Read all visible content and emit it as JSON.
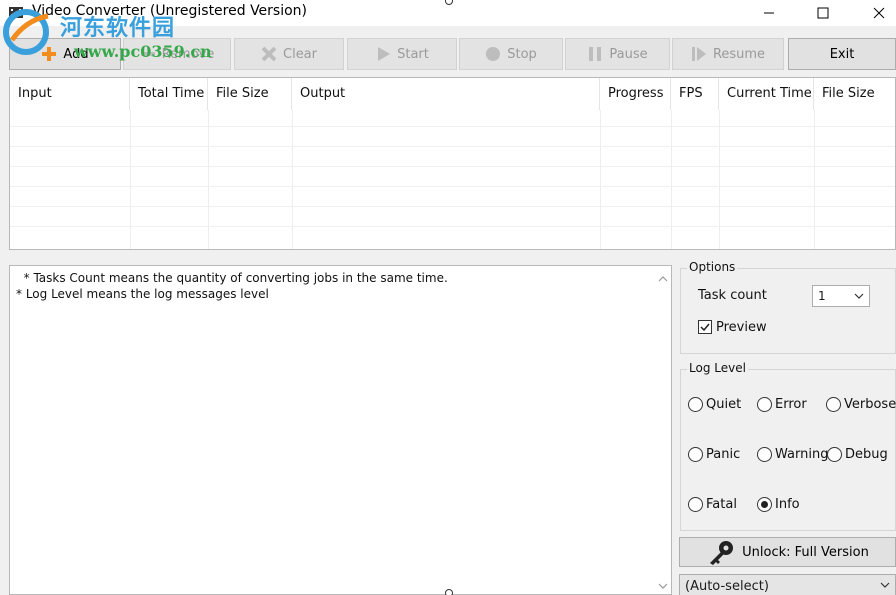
{
  "window": {
    "title": "Video Converter (Unregistered Version)"
  },
  "watermark": {
    "site_name": "河东软件园",
    "url": "www.pc0359.cn"
  },
  "toolbar": {
    "buttons": [
      {
        "label": "Add",
        "icon": "add-icon",
        "enabled": true
      },
      {
        "label": "Remove",
        "icon": "remove-icon",
        "enabled": false
      },
      {
        "label": "Clear",
        "icon": "clear-icon",
        "enabled": false
      },
      {
        "label": "Start",
        "icon": "start-icon",
        "enabled": false
      },
      {
        "label": "Stop",
        "icon": "stop-icon",
        "enabled": false
      },
      {
        "label": "Pause",
        "icon": "pause-icon",
        "enabled": false
      },
      {
        "label": "Resume",
        "icon": "resume-icon",
        "enabled": false
      },
      {
        "label": "Exit",
        "icon": "",
        "enabled": true
      }
    ]
  },
  "task_grid": {
    "columns": [
      "Input",
      "Total Time",
      "File Size",
      "Output",
      "Progress",
      "FPS",
      "Current Time",
      "File Size"
    ],
    "rows": []
  },
  "log": {
    "lines": [
      "  * Tasks Count means the quantity of converting jobs in the same time.",
      "* Log Level means the log messages level"
    ]
  },
  "options": {
    "title": "Options",
    "task_count_label": "Task count",
    "task_count_value": "1",
    "preview_label": "Preview",
    "preview_checked": true
  },
  "log_level": {
    "title": "Log Level",
    "levels": [
      "Quiet",
      "Error",
      "Verbose",
      "Panic",
      "Warning",
      "Debug",
      "Fatal",
      "Info"
    ],
    "selected": "Info"
  },
  "unlock": {
    "label": "Unlock: Full Version",
    "icon": "key-icon"
  },
  "codec_select": {
    "value": "(Auto-select)"
  },
  "colors": {
    "watermark_blue": "#3aa0dc",
    "watermark_green": "#35a84a",
    "add_orange": "#f28c1c"
  }
}
